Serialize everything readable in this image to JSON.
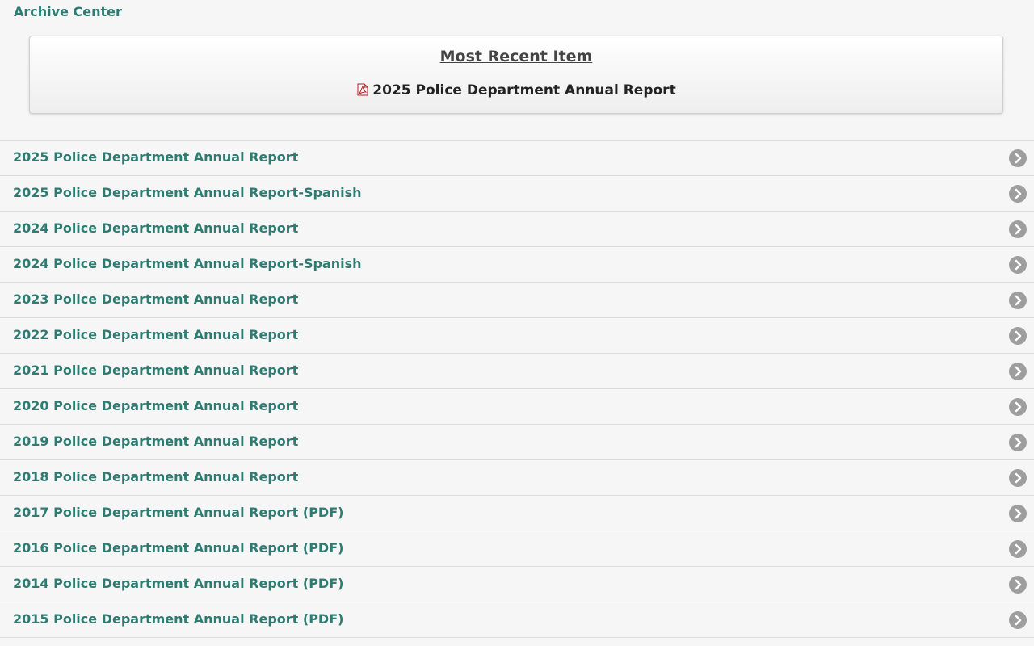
{
  "header": {
    "title": "Archive Center"
  },
  "recent": {
    "title": "Most Recent Item",
    "item_label": "2025 Police Department Annual Report",
    "item_icon": "pdf-icon"
  },
  "items": [
    {
      "label": "2025 Police Department Annual Report"
    },
    {
      "label": "2025 Police Department Annual Report-Spanish"
    },
    {
      "label": "2024 Police Department Annual Report"
    },
    {
      "label": "2024 Police Department Annual Report-Spanish"
    },
    {
      "label": "2023 Police Department Annual Report"
    },
    {
      "label": "2022 Police Department Annual Report"
    },
    {
      "label": "2021 Police Department Annual Report"
    },
    {
      "label": "2020 Police Department Annual Report"
    },
    {
      "label": "2019 Police Department Annual Report"
    },
    {
      "label": "2018 Police Department Annual Report"
    },
    {
      "label": "2017 Police Department Annual Report (PDF)"
    },
    {
      "label": "2016 Police Department Annual Report (PDF)"
    },
    {
      "label": "2014 Police Department Annual Report (PDF)"
    },
    {
      "label": "2015 Police Department Annual Report (PDF)"
    }
  ],
  "colors": {
    "accent": "#2e7b72",
    "arrow": "#9e9e9e",
    "background": "#f6f6f6"
  },
  "row_icon": "chevron-right-circle-icon"
}
